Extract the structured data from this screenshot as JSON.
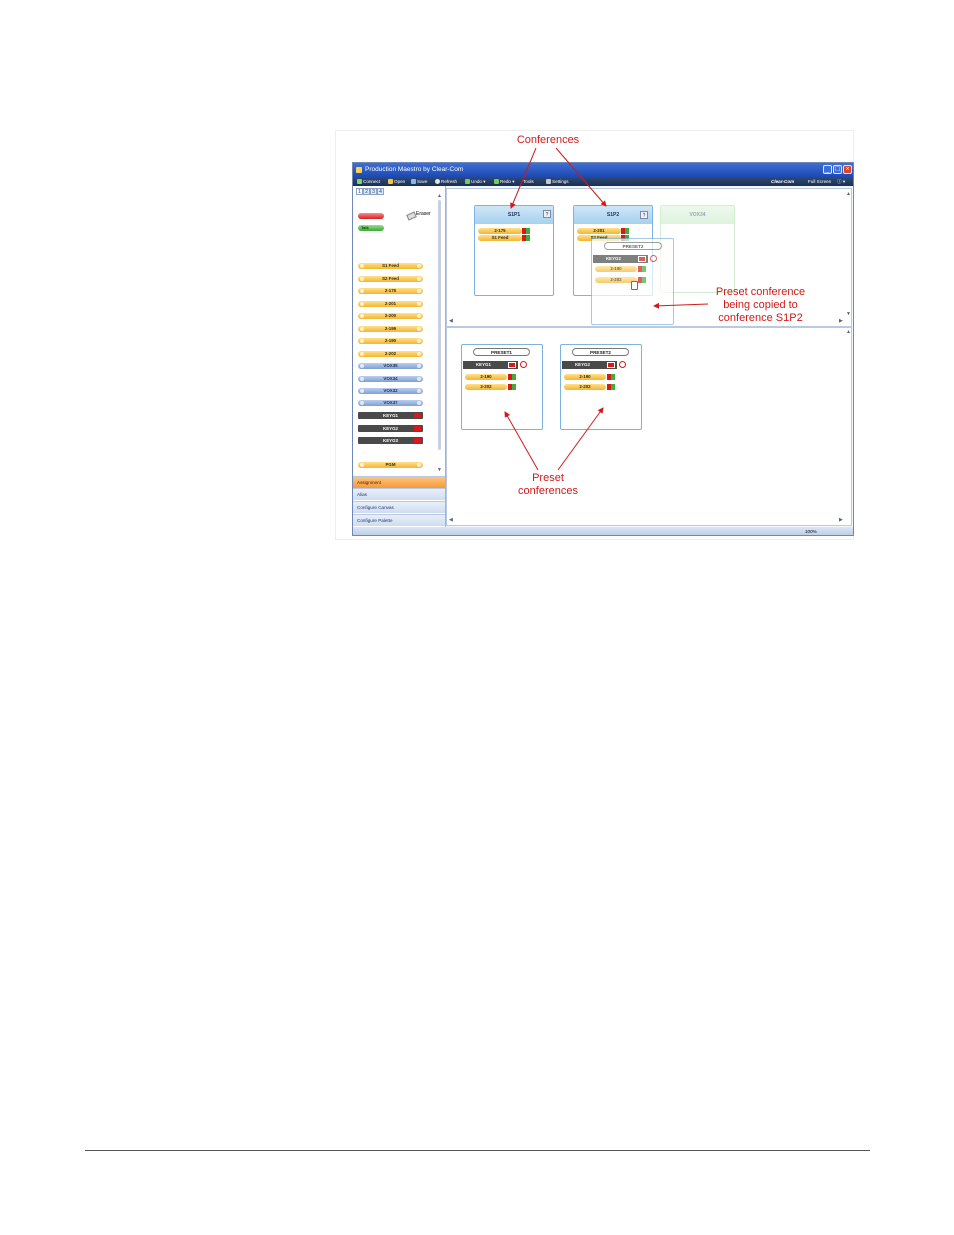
{
  "window": {
    "title": "Production Maestro by Clear-Com",
    "brand": "Clear-Com",
    "full_screen": "Full Screen"
  },
  "toolbar": {
    "connect": "Connect",
    "open": "Open",
    "save": "Save",
    "refresh": "Refresh",
    "undo": "Undo",
    "redo": "Redo",
    "tools": "Tools",
    "settings": "Settings"
  },
  "palette": {
    "tabs": [
      "1",
      "2",
      "3",
      "4"
    ],
    "eraser": "Eraser",
    "talk_label": "Talk",
    "items": [
      {
        "label": "S1 Feed",
        "kind": "orange"
      },
      {
        "label": "S2 Feed",
        "kind": "orange"
      },
      {
        "label": "2-175",
        "kind": "orange"
      },
      {
        "label": "2-201",
        "kind": "orange"
      },
      {
        "label": "2-200",
        "kind": "orange"
      },
      {
        "label": "2-199",
        "kind": "orange"
      },
      {
        "label": "2-190",
        "kind": "orange"
      },
      {
        "label": "2-202",
        "kind": "orange"
      },
      {
        "label": "VOX35",
        "kind": "blue"
      },
      {
        "label": "VOX34",
        "kind": "blue"
      },
      {
        "label": "VOX32",
        "kind": "blue"
      },
      {
        "label": "VOX37",
        "kind": "blue"
      },
      {
        "label": "KEYG1",
        "kind": "dark"
      },
      {
        "label": "KEYG2",
        "kind": "dark"
      },
      {
        "label": "KEYG3",
        "kind": "dark"
      },
      {
        "label": "PGM",
        "kind": "orange"
      }
    ],
    "accordion": [
      "Assignment",
      "Alias",
      "Configure Canvas",
      "Configure Palette"
    ]
  },
  "conferences": [
    {
      "name": "S1P1",
      "rows": [
        "2-175",
        "S1 Feed"
      ]
    },
    {
      "name": "S1P2",
      "rows": [
        "2-201",
        "S2 Feed"
      ]
    },
    {
      "name": "VOX34",
      "rows": []
    }
  ],
  "dragging_preset": {
    "name": "PRESET2",
    "key": "KEYG2",
    "rows": [
      "2-190",
      "2-202"
    ]
  },
  "presets": [
    {
      "name": "PRESET1",
      "key": "KEYG1",
      "rows": [
        "2-190",
        "2-202"
      ]
    },
    {
      "name": "PRESET2",
      "key": "KEYG2",
      "rows": [
        "2-190",
        "2-202"
      ]
    }
  ],
  "statusbar": {
    "zoom": "100%"
  },
  "callouts": {
    "conferences": "Conferences",
    "preset_copy": [
      "Preset conference",
      "being copied to",
      "conference S1P2"
    ],
    "preset_conferences": [
      "Preset",
      "conferences"
    ]
  },
  "colors": {
    "annotation": "#d11a1a",
    "title_bar": "#1c48b5",
    "toolbar": "#1b2f52",
    "conference_header": "#a6d1ee",
    "pill_orange": "#f2b531",
    "pill_blue": "#7f9fd3",
    "accordion_active": "#f39a3a"
  }
}
